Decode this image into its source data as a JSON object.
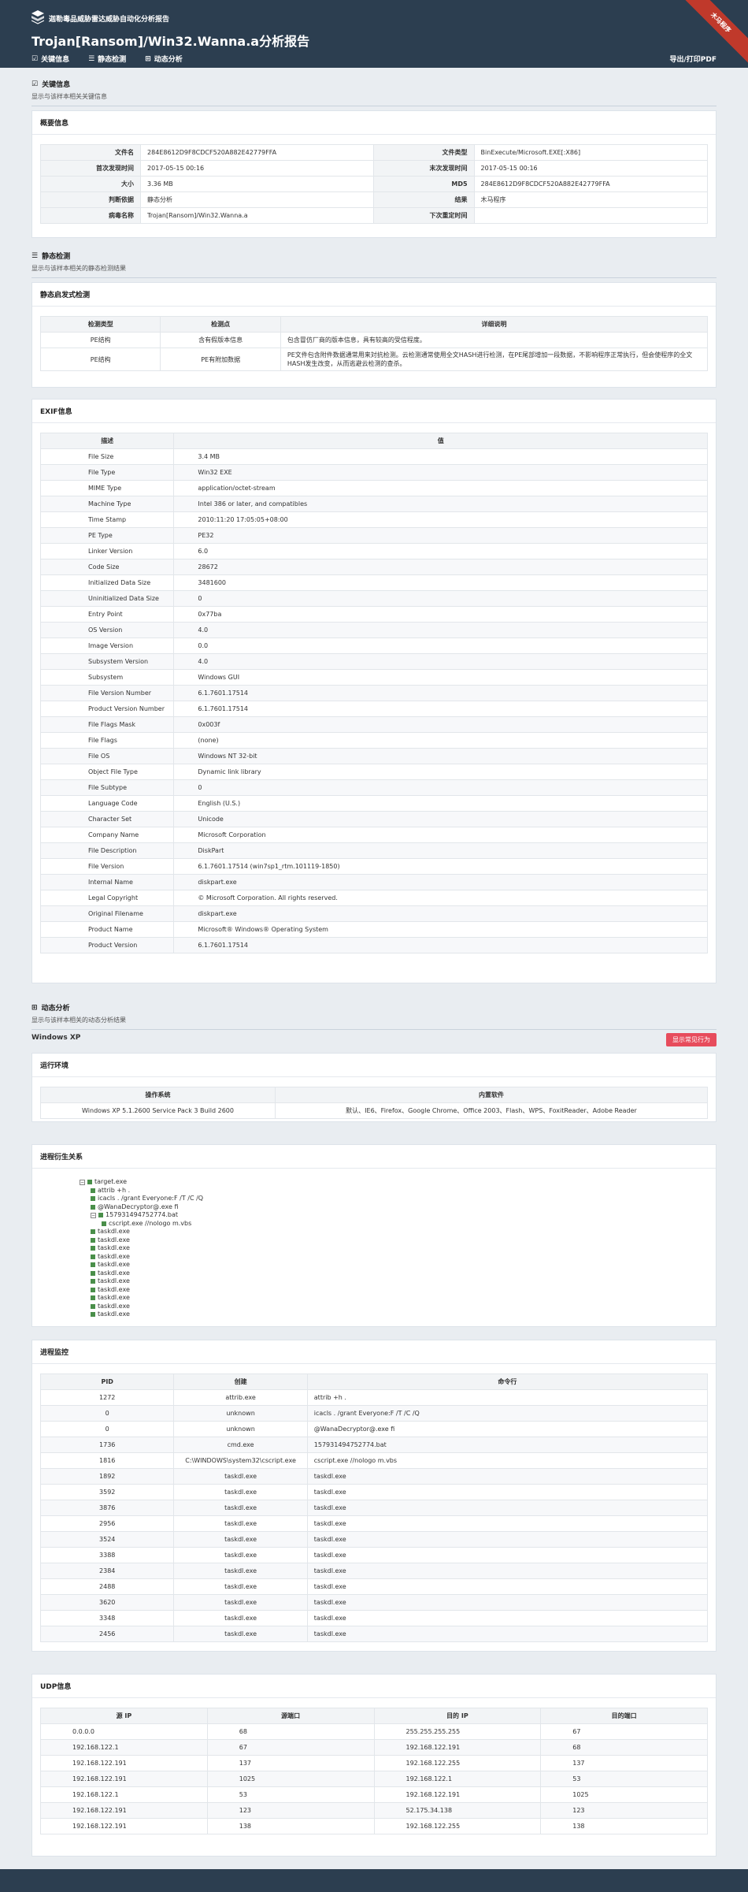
{
  "header": {
    "brand": "迦勒毒品威胁雷达威胁自动化分析报告",
    "title": "Trojan[Ransom]/Win32.Wanna.a分析报告",
    "ribbon": "木马程序",
    "nav": [
      "关键信息",
      "静态检测",
      "动态分析"
    ],
    "export": "导出/打印PDF"
  },
  "key_info": {
    "title": "关键信息",
    "sub": "显示与该样本相关关键信息",
    "panel_title": "概要信息",
    "rows": [
      [
        "文件名",
        "284E8612D9F8CDCF520A882E42779FFA",
        "文件类型",
        "BinExecute/Microsoft.EXE[:X86]"
      ],
      [
        "首次发现时间",
        "2017-05-15 00:16",
        "末次发现时间",
        "2017-05-15 00:16"
      ],
      [
        "大小",
        "3.36 MB",
        "MD5",
        "284E8612D9F8CDCF520A882E42779FFA"
      ],
      [
        "判断依据",
        "静态分析",
        "结果",
        "木马程序"
      ],
      [
        "病毒名称",
        "Trojan[Ransom]/Win32.Wanna.a",
        "下次重定时间",
        ""
      ]
    ]
  },
  "static": {
    "title": "静态检测",
    "sub": "显示与该样本相关的静态检测结果",
    "panel_title": "静态启发式检测",
    "headers": [
      "检测类型",
      "检测点",
      "详细说明"
    ],
    "rows": [
      [
        "PE结构",
        "含有假版本信息",
        "包含冒仿厂商的版本信息，具有较高的受信程度。"
      ],
      [
        "PE结构",
        "PE有附加数据",
        "PE文件包含附件数据通常用来対抗检测。云检测通常使用全文HASH进行检测，在PE尾部增加一段数据，不影响程序正常执行，但会使程序的全文HASH发生改变，从而逃避云检测的查杀。"
      ]
    ]
  },
  "exif": {
    "panel_title": "EXIF信息",
    "headers": [
      "描述",
      "值"
    ],
    "rows": [
      [
        "File Size",
        "3.4 MB"
      ],
      [
        "File Type",
        "Win32 EXE"
      ],
      [
        "MIME Type",
        "application/octet-stream"
      ],
      [
        "Machine Type",
        "Intel 386 or later, and compatibles"
      ],
      [
        "Time Stamp",
        "2010:11:20 17:05:05+08:00"
      ],
      [
        "PE Type",
        "PE32"
      ],
      [
        "Linker Version",
        "6.0"
      ],
      [
        "Code Size",
        "28672"
      ],
      [
        "Initialized Data Size",
        "3481600"
      ],
      [
        "Uninitialized Data Size",
        "0"
      ],
      [
        "Entry Point",
        "0x77ba"
      ],
      [
        "OS Version",
        "4.0"
      ],
      [
        "Image Version",
        "0.0"
      ],
      [
        "Subsystem Version",
        "4.0"
      ],
      [
        "Subsystem",
        "Windows GUI"
      ],
      [
        "File Version Number",
        "6.1.7601.17514"
      ],
      [
        "Product Version Number",
        "6.1.7601.17514"
      ],
      [
        "File Flags Mask",
        "0x003f"
      ],
      [
        "File Flags",
        "(none)"
      ],
      [
        "File OS",
        "Windows NT 32-bit"
      ],
      [
        "Object File Type",
        "Dynamic link library"
      ],
      [
        "File Subtype",
        "0"
      ],
      [
        "Language Code",
        "English (U.S.)"
      ],
      [
        "Character Set",
        "Unicode"
      ],
      [
        "Company Name",
        "Microsoft Corporation"
      ],
      [
        "File Description",
        "DiskPart"
      ],
      [
        "File Version",
        "6.1.7601.17514 (win7sp1_rtm.101119-1850)"
      ],
      [
        "Internal Name",
        "diskpart.exe"
      ],
      [
        "Legal Copyright",
        "© Microsoft Corporation. All rights reserved."
      ],
      [
        "Original Filename",
        "diskpart.exe"
      ],
      [
        "Product Name",
        "Microsoft® Windows® Operating System"
      ],
      [
        "Product Version",
        "6.1.7601.17514"
      ]
    ]
  },
  "dynamic": {
    "title": "动态分析",
    "sub": "显示与该样本相关的动态分析结果",
    "os_label": "Windows XP",
    "show_button": "显示常见行为",
    "env_title": "运行环境",
    "env_headers": [
      "操作系统",
      "内置软件"
    ],
    "env_row": [
      "Windows XP 5.1.2600 Service Pack 3 Build 2600",
      "默认、IE6、Firefox、Google Chrome、Office 2003、Flash、WPS、FoxitReader、Adobe Reader"
    ],
    "tree_title": "进程衍生关系",
    "tree": [
      {
        "level": 0,
        "toggle": "−",
        "text": "target.exe"
      },
      {
        "level": 1,
        "text": "attrib +h ."
      },
      {
        "level": 1,
        "text": "icacls . /grant Everyone:F /T /C /Q"
      },
      {
        "level": 1,
        "text": "@WanaDecryptor@.exe fi"
      },
      {
        "level": 1,
        "toggle": "−",
        "text": "157931494752774.bat"
      },
      {
        "level": 2,
        "text": "cscript.exe //nologo m.vbs"
      },
      {
        "level": 1,
        "text": "taskdl.exe"
      },
      {
        "level": 1,
        "text": "taskdl.exe"
      },
      {
        "level": 1,
        "text": "taskdl.exe"
      },
      {
        "level": 1,
        "text": "taskdl.exe"
      },
      {
        "level": 1,
        "text": "taskdl.exe"
      },
      {
        "level": 1,
        "text": "taskdl.exe"
      },
      {
        "level": 1,
        "text": "taskdl.exe"
      },
      {
        "level": 1,
        "text": "taskdl.exe"
      },
      {
        "level": 1,
        "text": "taskdl.exe"
      },
      {
        "level": 1,
        "text": "taskdl.exe"
      },
      {
        "level": 1,
        "text": "taskdl.exe"
      }
    ],
    "proc_title": "进程监控",
    "proc_headers": [
      "PID",
      "创建",
      "命令行"
    ],
    "proc_rows": [
      [
        "1272",
        "attrib.exe",
        "attrib +h ."
      ],
      [
        "0",
        "unknown",
        "icacls . /grant Everyone:F /T /C /Q"
      ],
      [
        "0",
        "unknown",
        "@WanaDecryptor@.exe fi"
      ],
      [
        "1736",
        "cmd.exe",
        "157931494752774.bat"
      ],
      [
        "1816",
        "C:\\WINDOWS\\system32\\cscript.exe",
        "cscript.exe //nologo m.vbs"
      ],
      [
        "1892",
        "taskdl.exe",
        "taskdl.exe"
      ],
      [
        "3592",
        "taskdl.exe",
        "taskdl.exe"
      ],
      [
        "3876",
        "taskdl.exe",
        "taskdl.exe"
      ],
      [
        "2956",
        "taskdl.exe",
        "taskdl.exe"
      ],
      [
        "3524",
        "taskdl.exe",
        "taskdl.exe"
      ],
      [
        "3388",
        "taskdl.exe",
        "taskdl.exe"
      ],
      [
        "2384",
        "taskdl.exe",
        "taskdl.exe"
      ],
      [
        "2488",
        "taskdl.exe",
        "taskdl.exe"
      ],
      [
        "3620",
        "taskdl.exe",
        "taskdl.exe"
      ],
      [
        "3348",
        "taskdl.exe",
        "taskdl.exe"
      ],
      [
        "2456",
        "taskdl.exe",
        "taskdl.exe"
      ]
    ],
    "udp_title": "UDP信息",
    "udp_headers": [
      "源 IP",
      "源端口",
      "目的 IP",
      "目的端口"
    ],
    "udp_rows": [
      [
        "0.0.0.0",
        "68",
        "255.255.255.255",
        "67"
      ],
      [
        "192.168.122.1",
        "67",
        "192.168.122.191",
        "68"
      ],
      [
        "192.168.122.191",
        "137",
        "192.168.122.255",
        "137"
      ],
      [
        "192.168.122.191",
        "1025",
        "192.168.122.1",
        "53"
      ],
      [
        "192.168.122.1",
        "53",
        "192.168.122.191",
        "1025"
      ],
      [
        "192.168.122.191",
        "123",
        "52.175.34.138",
        "123"
      ],
      [
        "192.168.122.191",
        "138",
        "192.168.122.255",
        "138"
      ]
    ]
  }
}
